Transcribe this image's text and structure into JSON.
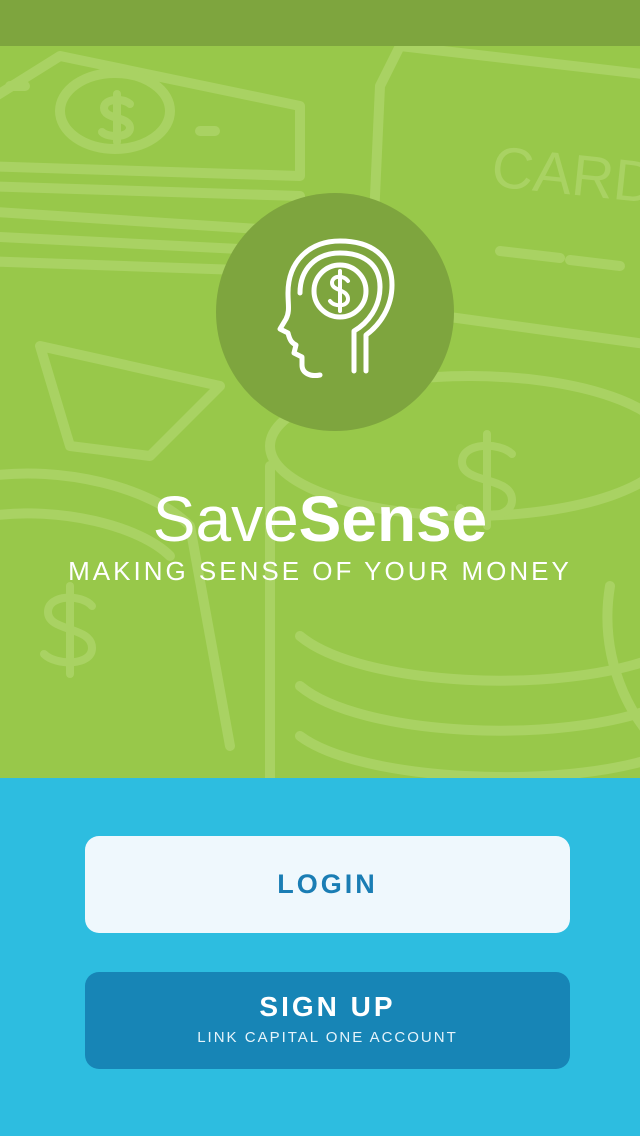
{
  "app": {
    "name_light": "Save",
    "name_bold": "Sense",
    "tagline": "MAKING SENSE OF YOUR MONEY"
  },
  "background_art": {
    "card_text": "CARD"
  },
  "buttons": {
    "login_label": "LOGIN",
    "signup_label": "SIGN UP",
    "signup_sublabel": "LINK CAPITAL ONE ACCOUNT"
  },
  "colors": {
    "status_bar": "#7ea53e",
    "hero_background": "#98c84a",
    "logo_circle": "#7ea53e",
    "actions_background": "#2dbde0",
    "login_button": "#eff8fd",
    "login_text": "#1a7db4",
    "signup_button": "#1785b6",
    "signup_text": "#ffffff"
  },
  "icons": {
    "logo": "head-with-dollar-icon"
  }
}
